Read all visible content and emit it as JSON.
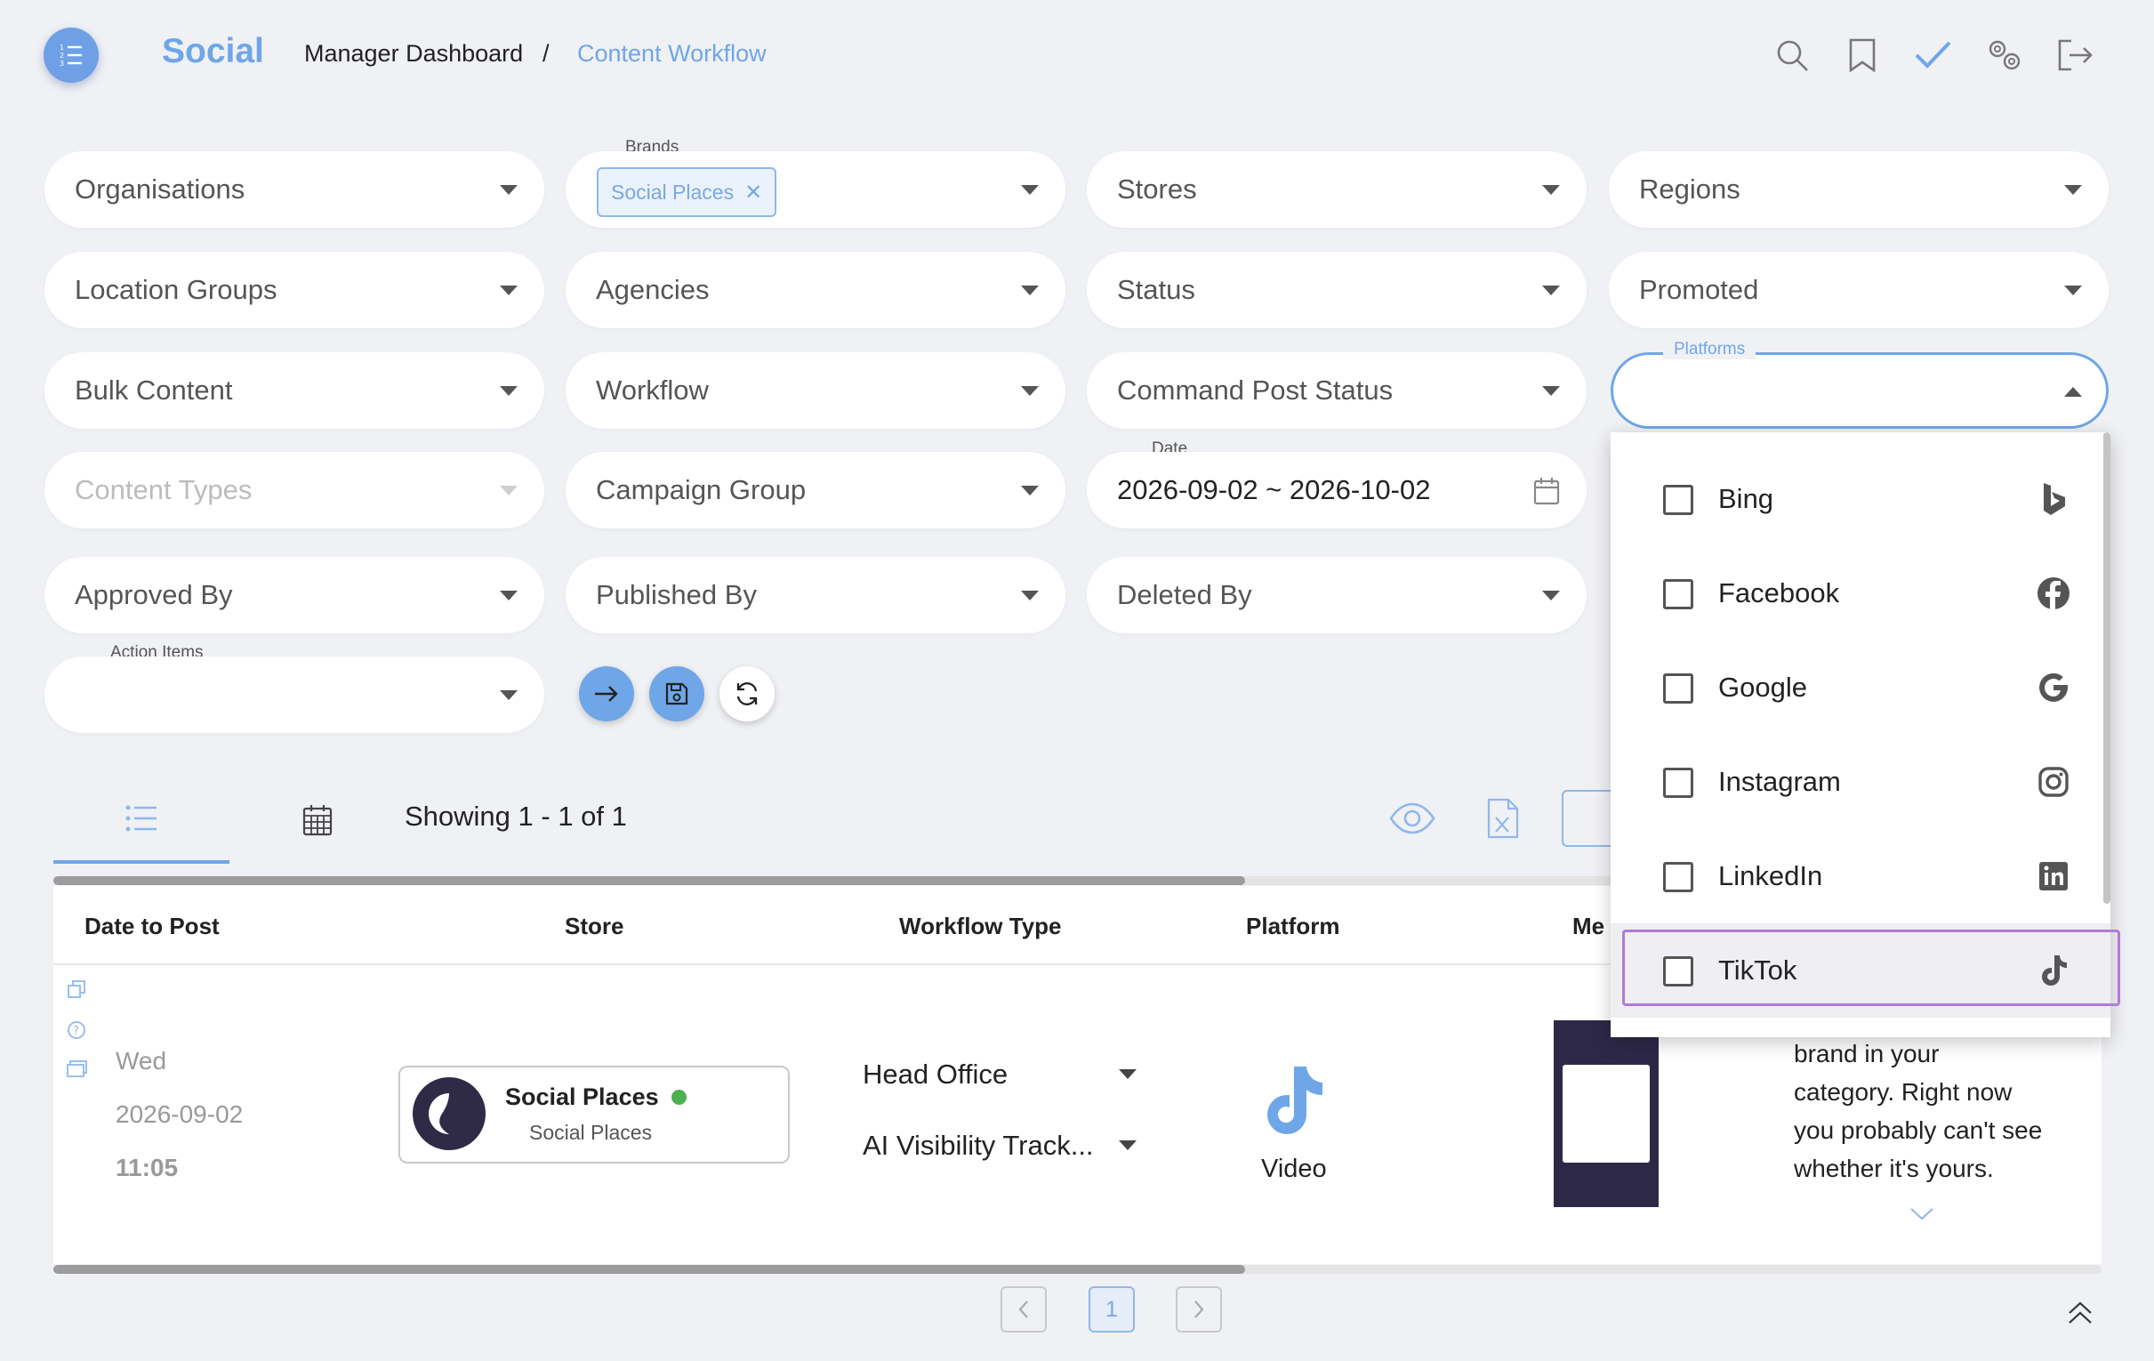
{
  "header": {
    "brand": "Social",
    "breadcrumb_root": "Manager Dashboard",
    "breadcrumb_sep": "/",
    "breadcrumb_current": "Content Workflow"
  },
  "filters": {
    "organisations": "Organisations",
    "brands_label": "Brands",
    "brands_chip": "Social Places",
    "stores": "Stores",
    "regions": "Regions",
    "location_groups": "Location Groups",
    "agencies": "Agencies",
    "status": "Status",
    "promoted": "Promoted",
    "bulk_content": "Bulk Content",
    "workflow": "Workflow",
    "command_post_status": "Command Post Status",
    "platforms_label": "Platforms",
    "content_types": "Content Types",
    "campaign_group": "Campaign Group",
    "date_label": "Date",
    "date_value": "2026-09-02 ~ 2026-10-02",
    "approved_by": "Approved By",
    "published_by": "Published By",
    "deleted_by": "Deleted By",
    "action_items_label": "Action Items"
  },
  "platform_options": [
    {
      "label": "Bing",
      "icon": "bing-icon",
      "checked": false
    },
    {
      "label": "Facebook",
      "icon": "facebook-icon",
      "checked": false
    },
    {
      "label": "Google",
      "icon": "google-icon",
      "checked": false
    },
    {
      "label": "Instagram",
      "icon": "instagram-icon",
      "checked": false
    },
    {
      "label": "LinkedIn",
      "icon": "linkedin-icon",
      "checked": false
    },
    {
      "label": "TikTok",
      "icon": "tiktok-icon",
      "checked": false
    }
  ],
  "results": {
    "showing": "Showing 1 - 1 of 1"
  },
  "table": {
    "columns": [
      "Date to Post",
      "Store",
      "Workflow Type",
      "Platform",
      "Me"
    ],
    "row": {
      "day": "Wed",
      "date": "2026-09-02",
      "time": "11:05",
      "store_name": "Social Places",
      "store_sub": "Social Places",
      "workflow_1": "Head Office",
      "workflow_2": "AI Visibility Track...",
      "platform_type": "Video",
      "message_lines": [
        "brand in your",
        "category. Right now",
        "you probably can't see",
        "whether it's yours."
      ]
    }
  },
  "pagination": {
    "current_page": "1"
  },
  "colors": {
    "accent": "#6fa6e8",
    "status_online": "#4caf50",
    "highlight_border": "#b27ad6"
  }
}
